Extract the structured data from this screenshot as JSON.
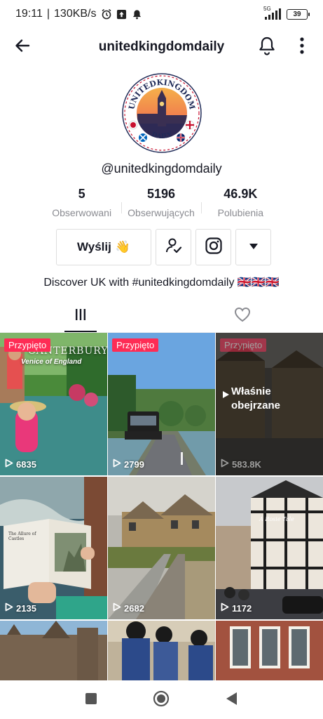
{
  "status_bar": {
    "time": "19:11",
    "separator": "|",
    "speed": "130KB/s",
    "network": "5G",
    "battery": "39"
  },
  "header": {
    "title": "unitedkingdomdaily",
    "icons": {
      "back": "back-arrow-icon",
      "bell": "bell-icon",
      "more": "more-vertical-icon"
    }
  },
  "avatar": {
    "top_text": "UNITEDKINGDOM",
    "bottom_text": "DAILY"
  },
  "profile": {
    "handle": "@unitedkingdomdaily",
    "bio": "Discover UK with #unitedkingdomdaily 🇬🇧🇬🇧🇬🇧"
  },
  "stats": [
    {
      "value": "5",
      "label": "Obserwowani"
    },
    {
      "value": "5196",
      "label": "Obserwujących"
    },
    {
      "value": "46.9K",
      "label": "Polubienia"
    }
  ],
  "actions": {
    "message_label": "Wyślij",
    "message_emoji": "👋",
    "icons": [
      "user-check-icon",
      "instagram-icon",
      "dropdown-triangle-icon"
    ]
  },
  "tabs": [
    {
      "icon": "grid-icon",
      "active": true
    },
    {
      "icon": "heart-outline-icon",
      "active": false
    }
  ],
  "videos": [
    {
      "pinned": "Przypięto",
      "views": "6835",
      "caption_title": "CANTERBURY",
      "caption_sub": "Venice of England"
    },
    {
      "pinned": "Przypięto",
      "views": "2799"
    },
    {
      "pinned": "Przypięto",
      "views": "583.8K",
      "overlay": "Właśnie obejrzane"
    },
    {
      "views": "2135",
      "book_text": "The Allure of Castles"
    },
    {
      "views": "2682"
    },
    {
      "views": "1172",
      "sign_text": "A Rosie Tale"
    },
    {},
    {},
    {}
  ],
  "colors": {
    "pin_badge": "#fe2c55",
    "text_primary": "#161823",
    "text_secondary": "#8a8b91"
  }
}
